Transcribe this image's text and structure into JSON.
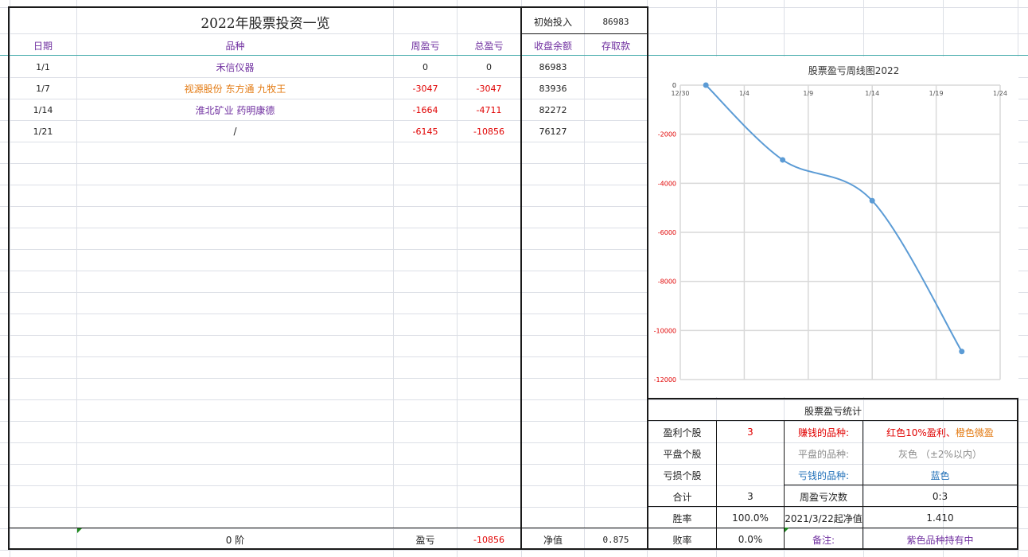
{
  "header": {
    "title": "2022年股票投资一览",
    "initial_label": "初始投入",
    "initial_value": "86983"
  },
  "columns": {
    "date": "日期",
    "variety": "品种",
    "week_pl": "周盈亏",
    "total_pl": "总盈亏",
    "balance": "收盘余额",
    "deposit": "存取款"
  },
  "rows": [
    {
      "date": "1/1",
      "variety": "禾信仪器",
      "variety_color": "#7030a0",
      "week_pl": "0",
      "week_color": "#222222",
      "total_pl": "0",
      "total_color": "#222222",
      "balance": "86983",
      "deposit": ""
    },
    {
      "date": "1/7",
      "variety": "视源股份 东方通 九牧王",
      "variety_color": "#e37a12",
      "week_pl": "-3047",
      "week_color": "#e00000",
      "total_pl": "-3047",
      "total_color": "#e00000",
      "balance": "83936",
      "deposit": ""
    },
    {
      "date": "1/14",
      "variety": "淮北矿业 药明康德",
      "variety_color": "#7030a0",
      "week_pl": "-1664",
      "week_color": "#e00000",
      "total_pl": "-4711",
      "total_color": "#e00000",
      "balance": "82272",
      "deposit": ""
    },
    {
      "date": "1/21",
      "variety": "/",
      "variety_color": "#222222",
      "week_pl": "-6145",
      "week_color": "#e00000",
      "total_pl": "-10856",
      "total_color": "#e00000",
      "balance": "76127",
      "deposit": ""
    }
  ],
  "footer": {
    "stage": "0 阶",
    "pl_label": "盈亏",
    "pl_value": "-10856",
    "nav_label": "净值",
    "nav_value": "0.875"
  },
  "chart_data": {
    "type": "line",
    "title": "股票盈亏周线图2022",
    "x": [
      "1/1",
      "1/7",
      "1/14",
      "1/21"
    ],
    "values": [
      0,
      -3047,
      -4711,
      -10856
    ],
    "x_ticks": [
      "12/30",
      "1/4",
      "1/9",
      "1/14",
      "1/19",
      "1/24"
    ],
    "y_ticks": [
      "0",
      "-2000",
      "-4000",
      "-6000",
      "-8000",
      "-10000",
      "-12000"
    ],
    "ylim": [
      -12000,
      0
    ],
    "xlim": [
      "12/30",
      "1/24"
    ],
    "grid": true,
    "smooth": true,
    "line_color": "#5b9bd5"
  },
  "stats": {
    "title": "股票盈亏统计",
    "rows": [
      {
        "label": "盈利个股",
        "value": "3",
        "value_color": "#e00000",
        "k": "赚钱的品种:",
        "k_color": "#e00000",
        "v": "红色10%盈利、橙色微盈",
        "v_color": "#e00000",
        "v2": "橙色微盈",
        "v2_color": "#e37a12"
      },
      {
        "label": "平盘个股",
        "value": "",
        "value_color": "#222222",
        "k": "平盘的品种:",
        "k_color": "#8a8a8a",
        "v": "灰色  （±2%以内）",
        "v_color": "#8a8a8a"
      },
      {
        "label": "亏损个股",
        "value": "",
        "value_color": "#222222",
        "k": "亏钱的品种:",
        "k_color": "#1f6fb8",
        "v": "蓝色",
        "v_color": "#1f6fb8"
      },
      {
        "label": "合计",
        "value": "3",
        "value_color": "#222222",
        "k": "周盈亏次数",
        "k_color": "#222222",
        "v": "0:3",
        "v_color": "#222222"
      },
      {
        "label": "胜率",
        "value": "100.0%",
        "value_color": "#222222",
        "k": "2021/3/22起净值",
        "k_color": "#222222",
        "v": "1.410",
        "v_color": "#222222"
      },
      {
        "label": "败率",
        "value": "0.0%",
        "value_color": "#222222",
        "k": "备注:",
        "k_color": "#7030a0",
        "v": "紫色品种持有中",
        "v_color": "#7030a0"
      }
    ],
    "profit_part1": "红色10%盈利、",
    "profit_part2": "橙色微盈"
  }
}
